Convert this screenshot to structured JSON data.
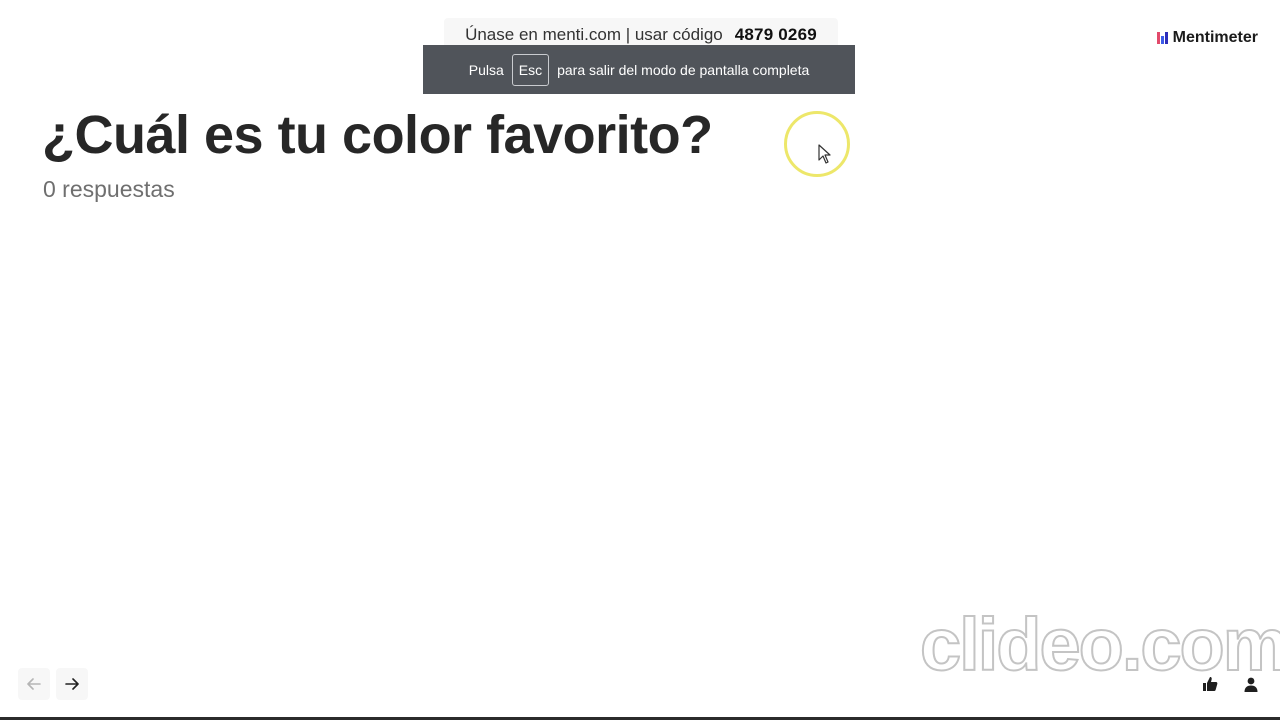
{
  "join_banner": {
    "text": "Únase en menti.com | usar código",
    "code": "4879 0269"
  },
  "fullscreen_toast": {
    "prefix": "Pulsa",
    "key": "Esc",
    "suffix": "para salir del modo de pantalla completa"
  },
  "brand": {
    "name": "Mentimeter",
    "logo_colors": [
      "#e24a6b",
      "#3c5be8",
      "#2d2dba"
    ]
  },
  "slide": {
    "question": "¿Cuál es tu color favorito?",
    "responses": "0 respuestas"
  },
  "navigation": {
    "prev_icon": "arrow-left-icon",
    "next_icon": "arrow-right-icon"
  },
  "watermark": {
    "text": "clideo.com"
  },
  "corner_actions": {
    "reactions_icon": "thumbs-up-icon",
    "participants_icon": "person-icon"
  },
  "colors": {
    "toast_bg": "#50545a",
    "cursor_highlight": "#ede76a",
    "question_text": "#272727"
  }
}
